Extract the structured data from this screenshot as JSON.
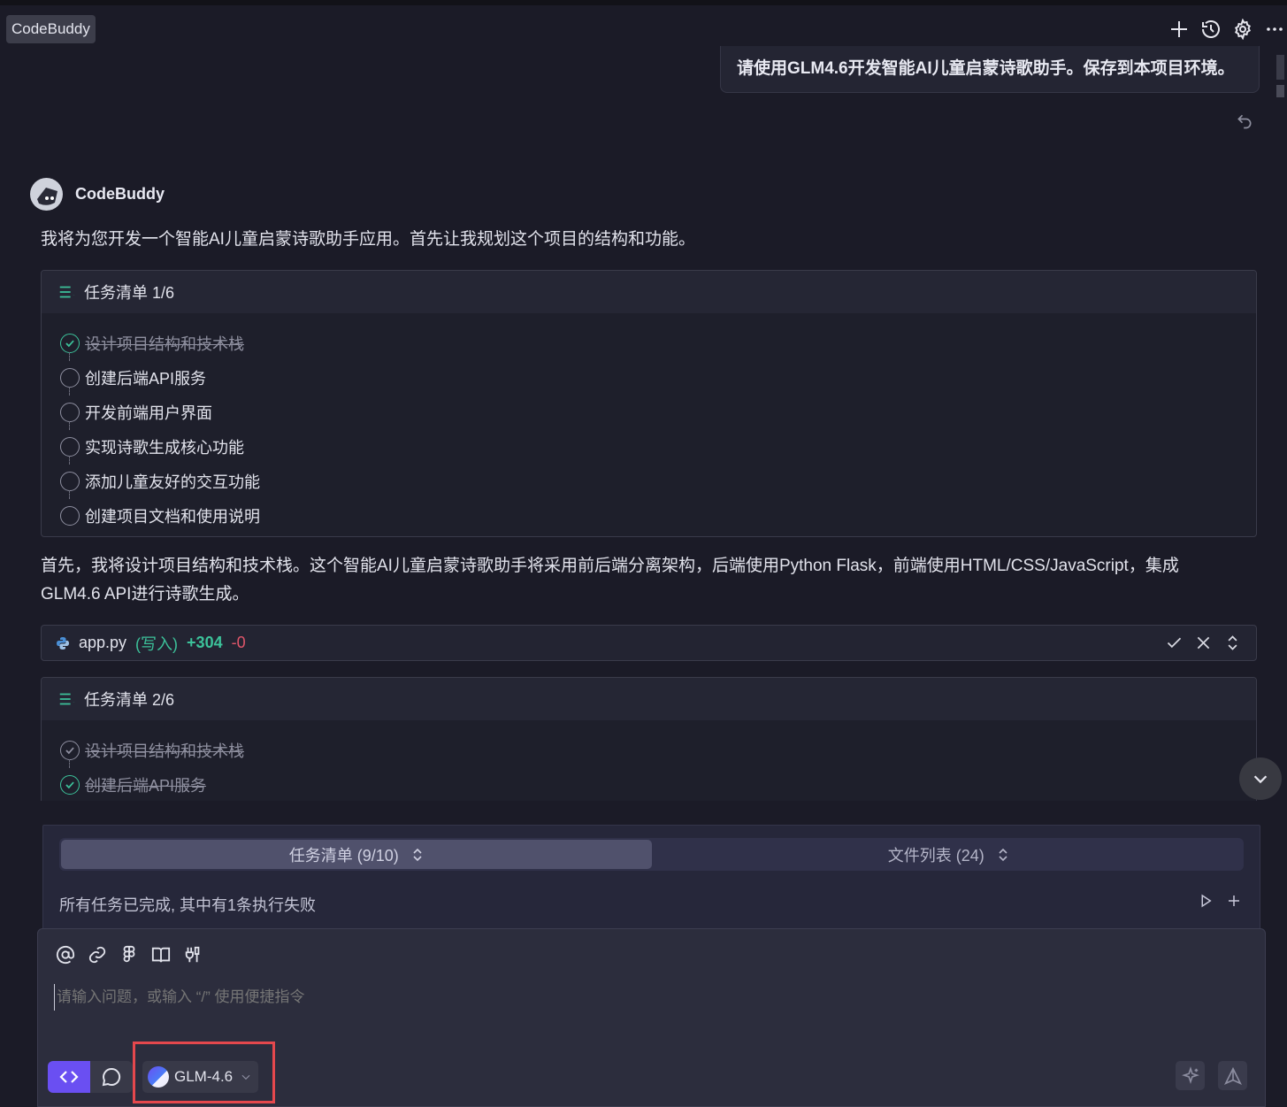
{
  "app": {
    "title": "CodeBuddy"
  },
  "user_message": "请使用GLM4.6开发智能AI儿童启蒙诗歌助手。保存到本项目环境。",
  "assistant": {
    "name": "CodeBuddy",
    "intro": "我将为您开发一个智能AI儿童启蒙诗歌助手应用。首先让我规划这个项目的结构和功能。",
    "task_list_1": {
      "title": "任务清单 1/6",
      "items": [
        {
          "label": "设计项目结构和技术栈",
          "status": "done"
        },
        {
          "label": "创建后端API服务",
          "status": "todo"
        },
        {
          "label": "开发前端用户界面",
          "status": "todo"
        },
        {
          "label": "实现诗歌生成核心功能",
          "status": "todo"
        },
        {
          "label": "添加儿童友好的交互功能",
          "status": "todo"
        },
        {
          "label": "创建项目文档和使用说明",
          "status": "todo"
        }
      ]
    },
    "paragraph_2_line1": "首先，我将设计项目结构和技术栈。这个智能AI儿童启蒙诗歌助手将采用前后端分离架构，后端使用Python Flask，前端使用HTML/CSS/JavaScript，集成",
    "paragraph_2_line2": "GLM4.6 API进行诗歌生成。",
    "file_change": {
      "name": "app.py",
      "mode": "(写入)",
      "added": "+304",
      "removed": "-0"
    },
    "task_list_2": {
      "title": "任务清单 2/6",
      "items": [
        {
          "label": "设计项目结构和技术栈",
          "status": "done"
        },
        {
          "label": "创建后端API服务",
          "status": "done"
        }
      ]
    }
  },
  "bottom_panel": {
    "tab_tasks": "任务清单 (9/10)",
    "tab_files": "文件列表 (24)",
    "status": "所有任务已完成, 其中有1条执行失败"
  },
  "composer": {
    "placeholder": "请输入问题，或输入 “/” 使用便捷指令",
    "model": "GLM-4.6"
  },
  "colors": {
    "accent": "#6a4ff2",
    "success": "#3cc29a",
    "danger": "#e0566a",
    "highlight": "#e5484d"
  }
}
